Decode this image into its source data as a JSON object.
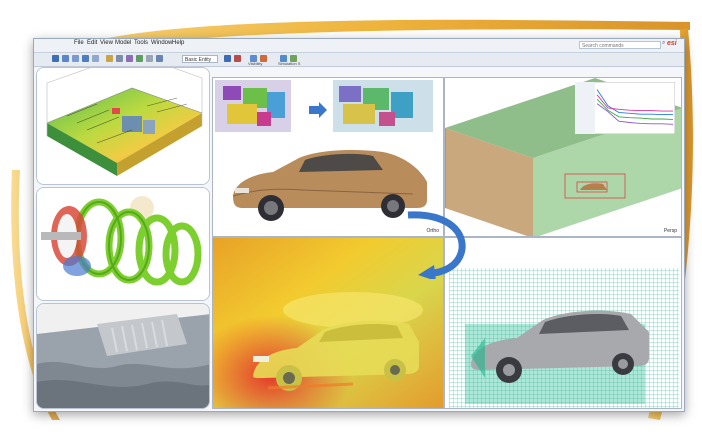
{
  "menu": {
    "items": [
      "File",
      "Edit",
      "View",
      "Model",
      "Tools",
      "Window",
      "Help"
    ]
  },
  "search": {
    "placeholder": "Search commands"
  },
  "brand": {
    "logo": "esi"
  },
  "toolbar": {
    "basic_entity": "Basic Entity",
    "visibility_label": "Visibility",
    "simulation_label": "Simulation S"
  },
  "viewports": {
    "top_center_label": "Ortho",
    "top_right_label": "Persp"
  },
  "chart_data": {
    "type": "line",
    "title": "",
    "xlabel": "",
    "ylabel": "",
    "series": [
      {
        "values": [
          0.92,
          0.55,
          0.4,
          0.38,
          0.36,
          0.36,
          0.35,
          0.35
        ],
        "color": "#2a7de1"
      },
      {
        "values": [
          0.8,
          0.5,
          0.47,
          0.45,
          0.44,
          0.44,
          0.43,
          0.43
        ],
        "color": "#e0339a"
      },
      {
        "values": [
          0.7,
          0.45,
          0.3,
          0.28,
          0.27,
          0.25,
          0.25,
          0.24
        ],
        "color": "#3aa845"
      },
      {
        "values": [
          0.6,
          0.42,
          0.2,
          0.17,
          0.15,
          0.14,
          0.14,
          0.13
        ],
        "color": "#8a5ad6"
      }
    ],
    "x": [
      0,
      1,
      2,
      3,
      4,
      5,
      6,
      7
    ]
  },
  "colors": {
    "swoosh": "#eeb43c",
    "accent_arrow": "#3a76c9",
    "window_border": "#9aa9bd"
  }
}
